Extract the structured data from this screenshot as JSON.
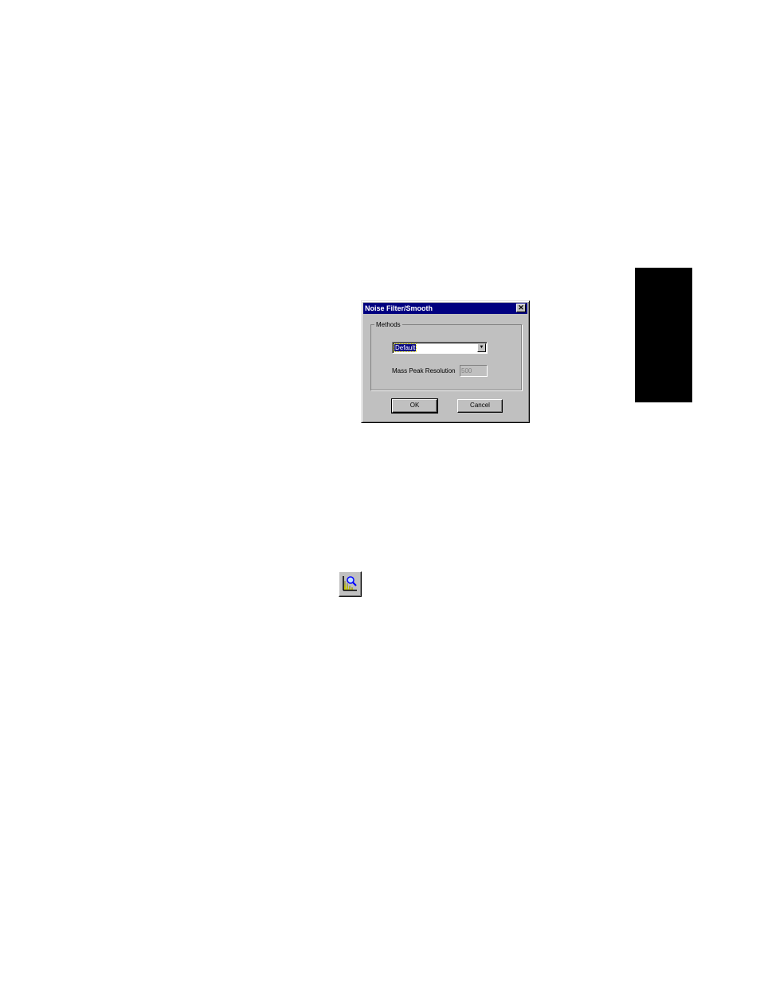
{
  "dialog": {
    "title": "Noise Filter/Smooth",
    "close_glyph": "✕",
    "group_label": "Methods",
    "method_select": {
      "selected": "Default",
      "arrow_glyph": "▼"
    },
    "resolution_field": {
      "label": "Mass Peak Resolution",
      "value": "500",
      "enabled": false
    },
    "ok_label": "OK",
    "cancel_label": "Cancel"
  },
  "toolbar_icon": {
    "name": "noise-filter-smooth-icon"
  },
  "colors": {
    "titlebar": "#000080",
    "dialog_face": "#c0c0c0",
    "edge_tab": "#000000",
    "icon_yellow": "#ffff00",
    "icon_blue": "#0000ff"
  }
}
